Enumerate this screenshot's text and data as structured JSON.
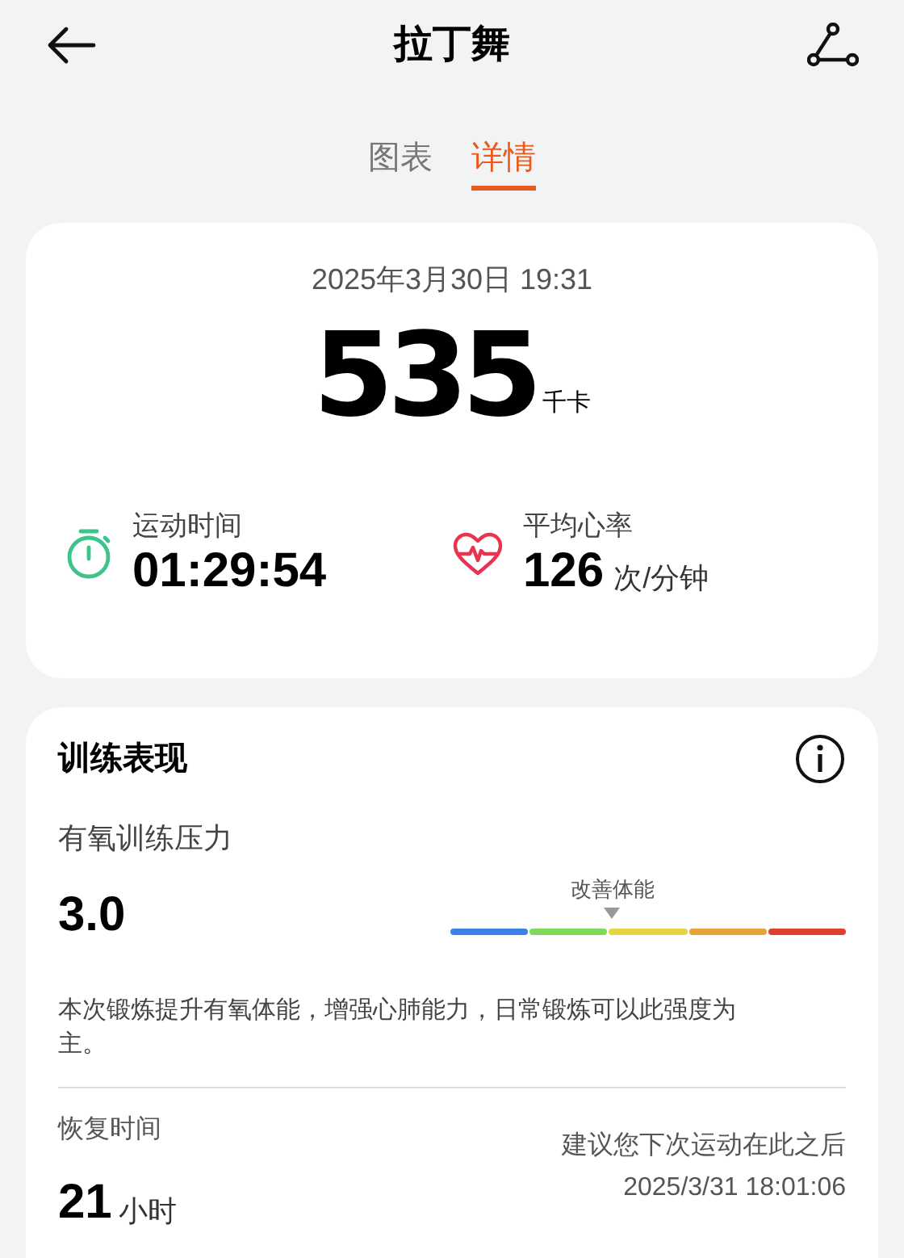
{
  "header": {
    "title": "拉丁舞"
  },
  "tabs": [
    {
      "label": "图表",
      "selected": false
    },
    {
      "label": "详情",
      "selected": true
    }
  ],
  "summary": {
    "datetime": "2025年3月30日 19:31",
    "calories": "535",
    "calories_unit": "千卡",
    "stats": [
      {
        "kind": "timer",
        "label": "运动时间",
        "value": "01:29:54"
      },
      {
        "kind": "heart",
        "label": "平均心率",
        "value": "126",
        "unit": "次/分钟"
      }
    ]
  },
  "training": {
    "title": "训练表现",
    "aerobic": {
      "label": "有氧训练压力",
      "value": "3.0",
      "marker_label": "改善体能",
      "segments": [
        {
          "color": "#3b82e6"
        },
        {
          "color": "#7ed957"
        },
        {
          "color": "#e6d444"
        },
        {
          "color": "#e8a23a"
        },
        {
          "color": "#e0412f"
        }
      ],
      "description": "本次锻炼提升有氧体能，增强心肺能力，日常锻炼可以此强度为主。"
    },
    "recovery": {
      "label": "恢复时间",
      "value": "21",
      "unit": "小时",
      "advice": "建议您下次运动在此之后",
      "until": "2025/3/31 18:01:06"
    }
  }
}
